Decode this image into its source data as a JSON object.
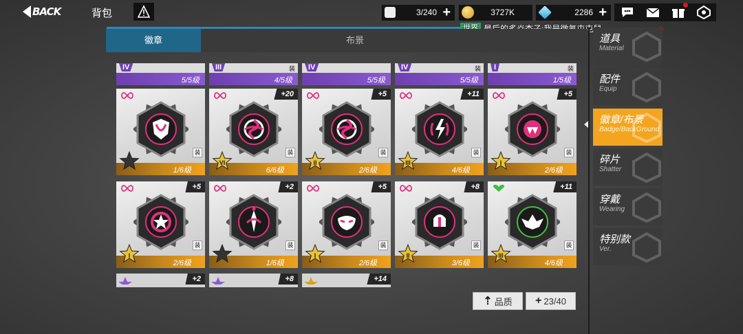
{
  "header": {
    "back_label": "BACK",
    "title": "背包"
  },
  "resources": {
    "bag": {
      "value": "3/240",
      "icon": "backpack-icon"
    },
    "gold": {
      "value": "3727K",
      "icon": "gold-coin-icon"
    },
    "gem": {
      "value": "2286",
      "icon": "diamond-icon"
    },
    "plus": "+"
  },
  "top_icons": [
    "chat-icon",
    "mail-icon",
    "gift-icon",
    "settings-icon"
  ],
  "chat": {
    "channel": "世界",
    "message": "最后的炙焱杏子:我是微氪屯屯鼠"
  },
  "tabs": [
    {
      "label": "徽章",
      "active": true
    },
    {
      "label": "布景",
      "active": false
    }
  ],
  "top_row": [
    {
      "rank": "IV",
      "level": "5/5级",
      "zhuang": ""
    },
    {
      "rank": "III",
      "level": "4/5级",
      "zhuang": "装"
    },
    {
      "rank": "IV",
      "level": "5/5级",
      "zhuang": ""
    },
    {
      "rank": "IV",
      "level": "5/5级",
      "zhuang": "装"
    },
    {
      "rank": "I",
      "level": "1/5级",
      "zhuang": "装"
    }
  ],
  "cards": [
    {
      "bonus": "",
      "rank": "",
      "level": "1/6级",
      "zhuang": "装",
      "emblem": "shield",
      "rank_color": "#333333",
      "special": false
    },
    {
      "bonus": "+20",
      "rank": "VI",
      "level": "6/6级",
      "zhuang": "装",
      "emblem": "swirl",
      "rank_color": "#e8c23a",
      "special": false
    },
    {
      "bonus": "+5",
      "rank": "II",
      "level": "2/6级",
      "zhuang": "装",
      "emblem": "swirl",
      "rank_color": "#e8c23a",
      "special": false
    },
    {
      "bonus": "+11",
      "rank": "III",
      "level": "4/6级",
      "zhuang": "装",
      "emblem": "bolt",
      "rank_color": "#e8c23a",
      "special": false
    },
    {
      "bonus": "+5",
      "rank": "I",
      "level": "2/6级",
      "zhuang": "装",
      "emblem": "fang",
      "rank_color": "#e8c23a",
      "special": false
    },
    {
      "bonus": "+5",
      "rank": "I",
      "level": "2/6级",
      "zhuang": "装",
      "emblem": "star",
      "rank_color": "#e8c23a",
      "special": false
    },
    {
      "bonus": "+2",
      "rank": "",
      "level": "1/6级",
      "zhuang": "装",
      "emblem": "sword",
      "rank_color": "#333333",
      "special": false
    },
    {
      "bonus": "+5",
      "rank": "I",
      "level": "2/6级",
      "zhuang": "装",
      "emblem": "mask",
      "rank_color": "#e8c23a",
      "special": false
    },
    {
      "bonus": "+8",
      "rank": "II",
      "level": "3/6级",
      "zhuang": "装",
      "emblem": "helm",
      "rank_color": "#e8c23a",
      "special": false
    },
    {
      "bonus": "+11",
      "rank": "III",
      "level": "4/6级",
      "zhuang": "装",
      "emblem": "wings",
      "rank_color": "#e8c23a",
      "special": true
    }
  ],
  "bottom_partial": [
    {
      "bonus": "+2"
    },
    {
      "bonus": "+8"
    },
    {
      "bonus": "+14"
    }
  ],
  "buttons": {
    "quality": "品质",
    "capacity": "23/40"
  },
  "side_menu": [
    {
      "zh": "道具",
      "en": "Material",
      "active": false
    },
    {
      "zh": "配件",
      "en": "Equip",
      "active": false
    },
    {
      "zh": "徽章/布景",
      "en": "Badge/BackGround",
      "active": true
    },
    {
      "zh": "碎片",
      "en": "Shatter",
      "active": false
    },
    {
      "zh": "穿戴",
      "en": "Wearing",
      "active": false
    },
    {
      "zh": "特别款",
      "en": "Ver.",
      "active": false
    }
  ],
  "colors": {
    "accent_blue": "#1f6689",
    "level_orange": "#f0a21e",
    "purple": "#7a4cc0",
    "magenta": "#e0307a",
    "green_special": "#3fbf3f"
  }
}
